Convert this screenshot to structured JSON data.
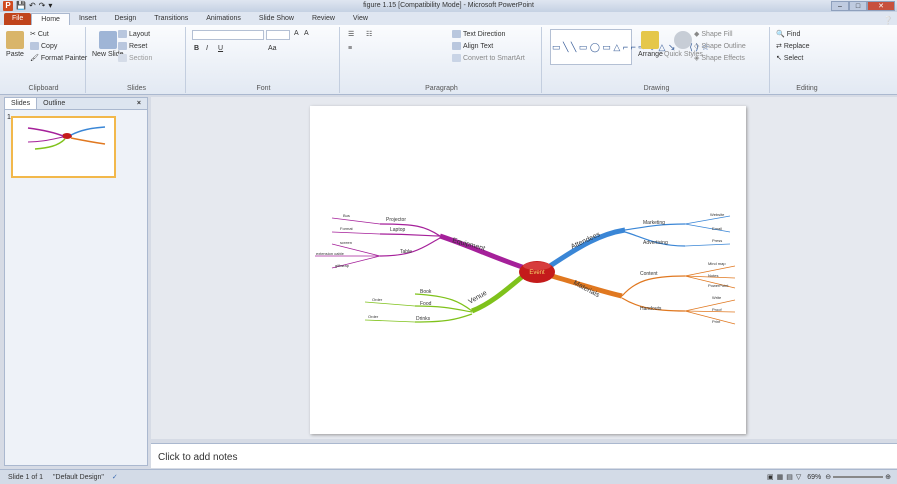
{
  "window": {
    "title": "figure 1.15 [Compatibility Mode] - Microsoft PowerPoint",
    "file_tab": "File",
    "tabs": [
      "Home",
      "Insert",
      "Design",
      "Transitions",
      "Animations",
      "Slide Show",
      "Review",
      "View"
    ]
  },
  "ribbon": {
    "clipboard": {
      "paste": "Paste",
      "cut": "Cut",
      "copy": "Copy",
      "format_painter": "Format Painter",
      "label": "Clipboard"
    },
    "slides": {
      "new_slide": "New Slide",
      "layout": "Layout",
      "reset": "Reset",
      "section": "Section",
      "label": "Slides"
    },
    "font": {
      "label": "Font",
      "bold": "B",
      "italic": "I",
      "underline": "U",
      "grow": "A",
      "shrink": "A",
      "clear": "Aa"
    },
    "paragraph": {
      "text_direction": "Text Direction",
      "align_text": "Align Text",
      "convert_smartart": "Convert to SmartArt",
      "label": "Paragraph"
    },
    "drawing": {
      "arrange": "Arrange",
      "quick_styles": "Quick Styles",
      "shape_fill": "Shape Fill",
      "shape_outline": "Shape Outline",
      "shape_effects": "Shape Effects",
      "label": "Drawing"
    },
    "editing": {
      "find": "Find",
      "replace": "Replace",
      "select": "Select",
      "label": "Editing"
    }
  },
  "panel": {
    "tab_slides": "Slides",
    "tab_outline": "Outline",
    "close": "×",
    "slide_number": "1"
  },
  "notes_placeholder": "Click to add notes",
  "status": {
    "slide_info": "Slide 1 of 1",
    "theme": "\"Default Design\"",
    "zoom": "69%"
  },
  "mindmap": {
    "center": "Event",
    "branches": {
      "equipment": "Equipment",
      "attendees": "Attendees",
      "venue": "Venue",
      "materials": "Materials"
    },
    "equipment_items": [
      "Projector",
      "Laptop",
      "Table"
    ],
    "equipment_leaves": [
      "Bus",
      "Format",
      "screen",
      "extension cable",
      "giftwrap"
    ],
    "attendees_items": [
      "Marketing",
      "Advertising"
    ],
    "attendees_leaves": [
      "Website",
      "Email",
      "Press"
    ],
    "venue_items": [
      "Book",
      "Food",
      "Drinks"
    ],
    "venue_leaves": [
      "Order",
      "Order"
    ],
    "materials_items": [
      "Content",
      "Handouts"
    ],
    "materials_leaves": [
      "Mind map",
      "Notes",
      "PowerPoint",
      "Write",
      "Proof",
      "Print"
    ]
  },
  "colors": {
    "equipment": "#a5209a",
    "attendees": "#3a86d6",
    "venue": "#7fc21b",
    "materials": "#e07820",
    "center": "#c41b1b"
  }
}
